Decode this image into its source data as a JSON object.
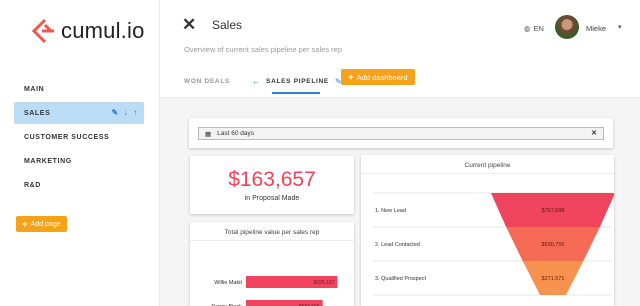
{
  "brand": {
    "name": "cumul.io",
    "accent": "#f5a21b"
  },
  "sidebar": {
    "items": [
      {
        "label": "MAIN"
      },
      {
        "label": "SALES",
        "active": true
      },
      {
        "label": "CUSTOMER SUCCESS"
      },
      {
        "label": "MARKETING"
      },
      {
        "label": "R&D"
      }
    ],
    "add_page_label": "Add page"
  },
  "header": {
    "close_icon": "close-icon",
    "title": "Sales",
    "subtitle": "Overview of current sales pipeline per sales rep",
    "language": "EN",
    "user_name": "Mieke",
    "tabs": [
      {
        "label": "WON DEALS"
      },
      {
        "label": "SALES PIPELINE",
        "active": true
      }
    ],
    "add_dashboard_label": "Add dashboard"
  },
  "dashboard": {
    "date_filter": "Last 60 days",
    "kpi": {
      "value": "$163,657",
      "label": "in Proposal Made",
      "color": "#f0435d"
    },
    "bar_chart_title": "Total pipeline value per sales rep",
    "funnel_title": "Current pipeline"
  },
  "chart_data": [
    {
      "type": "bar",
      "orientation": "horizontal",
      "title": "Total pipeline value per sales rep",
      "categories": [
        "Willie Makit",
        "Penny Black"
      ],
      "values": [
        695197,
        583665
      ],
      "value_labels": [
        "$695,197",
        "$583,665"
      ],
      "color": "#f0435d"
    },
    {
      "type": "funnel",
      "title": "Current pipeline",
      "categories": [
        "1. New Lead",
        "2. Lead Contacted",
        "3. Qualified Prospect"
      ],
      "values": [
        767698,
        530755,
        271571
      ],
      "value_labels": [
        "$767,698",
        "$530,755",
        "$271,571"
      ],
      "colors": [
        "#f0435d",
        "#f56a55",
        "#f7934e"
      ]
    }
  ]
}
